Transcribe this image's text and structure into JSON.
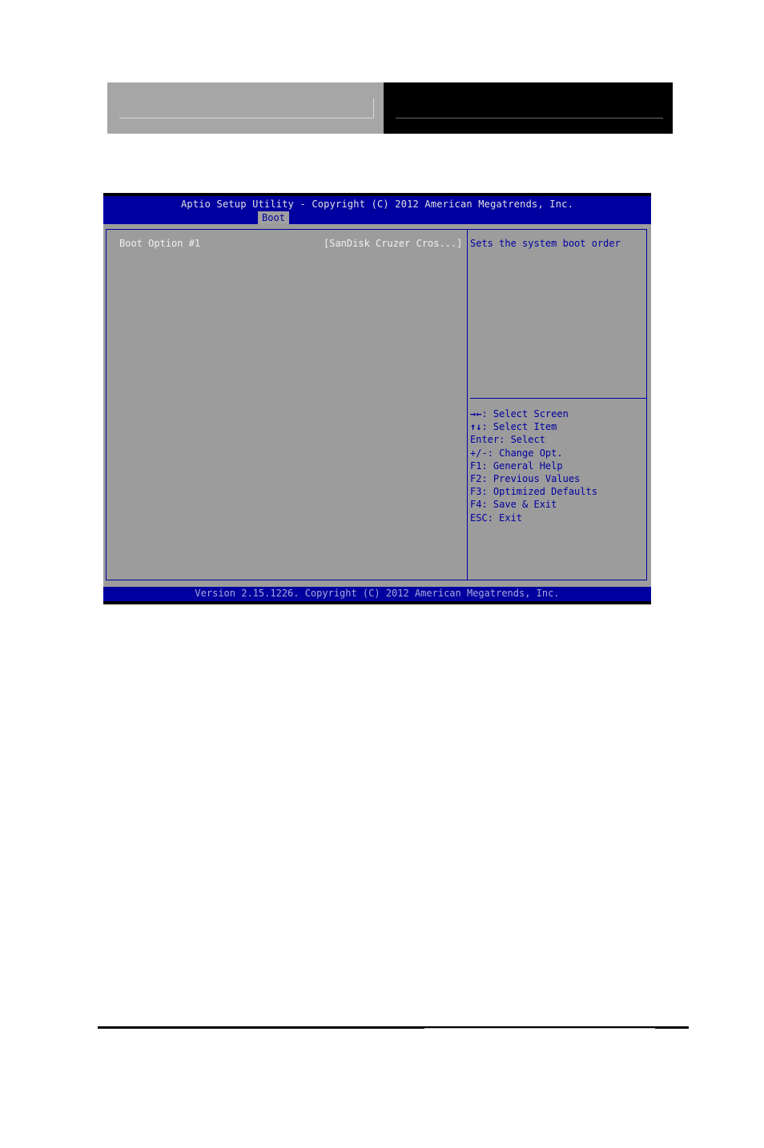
{
  "bios": {
    "title": "Aptio Setup Utility - Copyright (C) 2012 American Megatrends, Inc.",
    "active_tab": "Boot",
    "items": [
      {
        "label": "Boot Option #1",
        "value": "[SanDisk Cruzer Cros...]"
      }
    ],
    "help_text": "Sets the system boot order",
    "keys": [
      {
        "key": "→←",
        "action": ": Select Screen"
      },
      {
        "key": "↑↓",
        "action": ": Select Item"
      },
      {
        "key": "Enter",
        "action": ": Select"
      },
      {
        "key": "+/-",
        "action": ": Change Opt."
      },
      {
        "key": "F1",
        "action": ": General Help"
      },
      {
        "key": "F2",
        "action": ": Previous Values"
      },
      {
        "key": "F3",
        "action": ": Optimized Defaults"
      },
      {
        "key": "F4",
        "action": ": Save & Exit"
      },
      {
        "key": "ESC",
        "action": ": Exit"
      }
    ],
    "footer": "Version 2.15.1226. Copyright (C) 2012 American Megatrends, Inc.",
    "colors": {
      "blue": "#0000a0",
      "gray": "#9c9c9c",
      "white_text": "#f0f0f0"
    }
  }
}
